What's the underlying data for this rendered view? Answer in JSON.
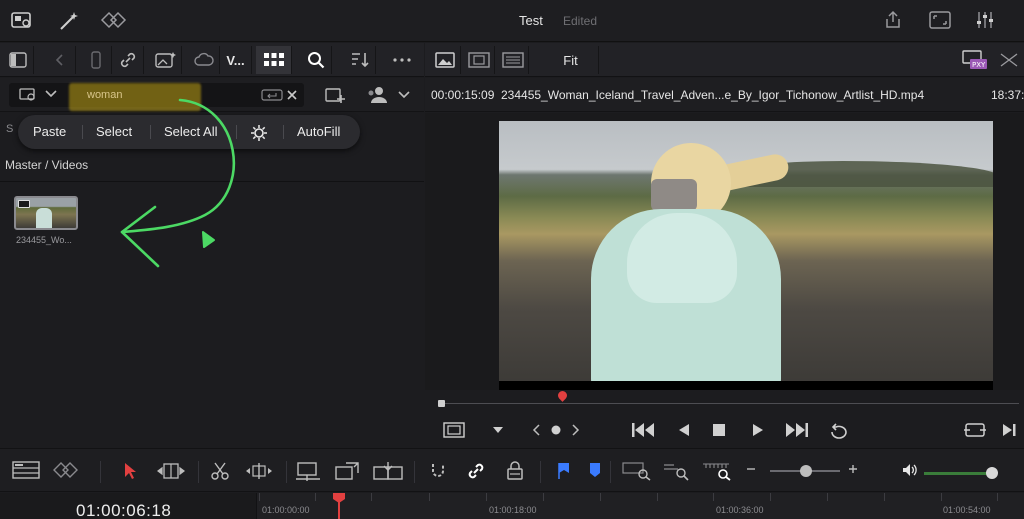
{
  "topbar": {
    "project_title": "Test",
    "status": "Edited"
  },
  "left_toolbar": {
    "view_label": "V..."
  },
  "search": {
    "query": "woman"
  },
  "context_menu": {
    "items": [
      "Paste",
      "Select",
      "Select All",
      "AutoFill"
    ],
    "peek": "S"
  },
  "media_pool": {
    "path": "Master / Videos",
    "clips": [
      {
        "name": "234455_Wo..."
      }
    ]
  },
  "viewer": {
    "zoom": "Fit",
    "source_timecode": "00:00:15:09",
    "clip_file": "234455_Woman_Iceland_Travel_Adven...e_By_Igor_Tichonow_Artlist_HD.mp4",
    "record_timecode": "18:37:"
  },
  "timeline": {
    "timecode": "01:00:06:18",
    "ruler_labels": [
      "01:00:00:00",
      "01:00:18:00",
      "01:00:36:00",
      "01:00:54:00"
    ]
  },
  "colors": {
    "accent": "#e24040",
    "annotation": "#4cd964",
    "highlight": "#c9a514"
  }
}
